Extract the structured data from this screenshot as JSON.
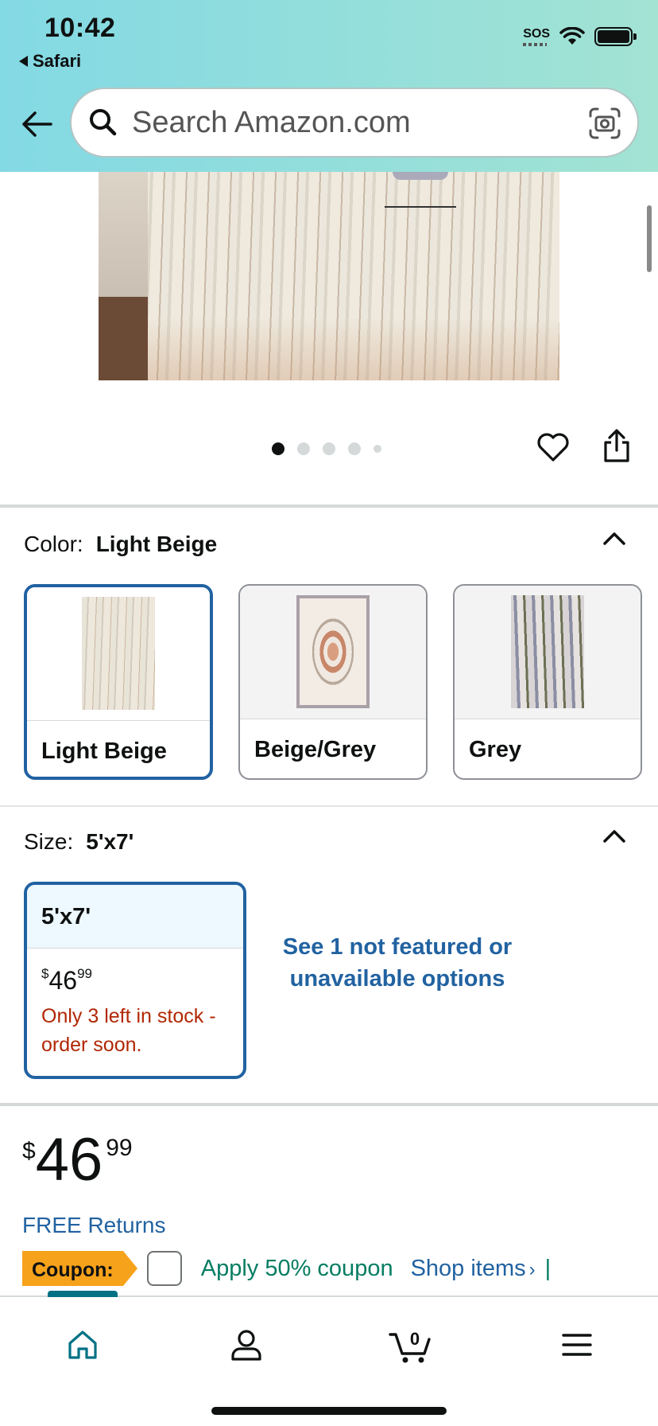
{
  "status_bar": {
    "time": "10:42",
    "back_app": "Safari",
    "sos": "SOS"
  },
  "search": {
    "placeholder": "Search Amazon.com"
  },
  "gallery": {
    "dot_count": 5,
    "active_index": 0
  },
  "color": {
    "label": "Color:",
    "selected": "Light Beige",
    "options": [
      {
        "label": "Light Beige",
        "selected": true
      },
      {
        "label": "Beige/Grey",
        "selected": false
      },
      {
        "label": "Grey",
        "selected": false
      }
    ]
  },
  "size": {
    "label": "Size:",
    "selected": "5'x7'",
    "option": {
      "label": "5'x7'",
      "currency": "$",
      "price_whole": "46",
      "price_fraction": "99",
      "stock": "Only 3 left in stock - order soon."
    },
    "not_featured_link": "See 1 not featured or unavailable options"
  },
  "price": {
    "currency": "$",
    "whole": "46",
    "fraction": "99"
  },
  "free_returns": "FREE Returns",
  "coupon": {
    "badge": "Coupon:",
    "text": "Apply 50% coupon",
    "shop_link": "Shop items",
    "chevron": "›",
    "separator": "|"
  },
  "bottom_nav": {
    "items": [
      "home-icon",
      "account-icon",
      "cart-icon",
      "menu-icon"
    ],
    "cart_count": "0",
    "accent": "#007185"
  },
  "colors": {
    "link": "#2162a1",
    "stock_red": "#b12704",
    "coupon_green": "#067d62",
    "coupon_orange": "#f7a21b"
  }
}
